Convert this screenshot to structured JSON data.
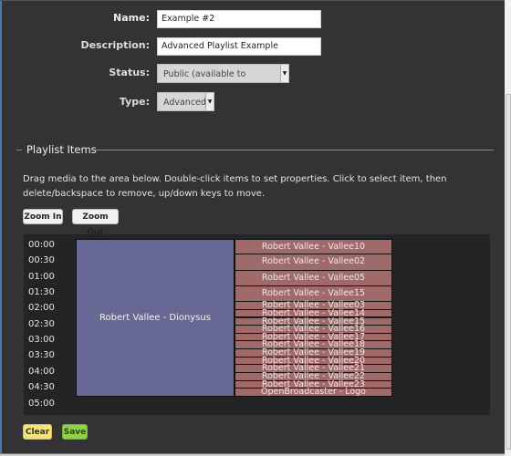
{
  "form": {
    "name_label": "Name:",
    "name_value": "Example #2",
    "description_label": "Description:",
    "description_value": "Advanced Playlist Example",
    "status_label": "Status:",
    "status_value": "Public (available to everyone)",
    "type_label": "Type:",
    "type_value": "Advanced"
  },
  "playlist": {
    "legend": "Playlist Items",
    "help_text": "Drag media to the area below. Double-click items to set properties. Click to select item, then delete/backspace to remove, up/down keys to move.",
    "zoom_in_label": "Zoom In",
    "zoom_out_label": "Zoom Out",
    "time_ticks": [
      "00:00",
      "00:30",
      "01:00",
      "01:30",
      "02:00",
      "02:30",
      "03:00",
      "03:30",
      "04:00",
      "04:30",
      "05:00"
    ],
    "timeline_total_minutes": 300,
    "main_track": {
      "label": "Robert Vallee - Dionysus",
      "start_min": 0,
      "duration_min": 300,
      "color": "#686894"
    },
    "overlay_items": [
      {
        "label": "Robert Vallee - Vallee10",
        "duration_min": 30
      },
      {
        "label": "Robert Vallee - Vallee02",
        "duration_min": 30
      },
      {
        "label": "Robert Vallee - Vallee05",
        "duration_min": 30
      },
      {
        "label": "Robert Vallee - Vallee15",
        "duration_min": 30
      },
      {
        "label": "Robert Vallee - Vallee03",
        "duration_min": 15
      },
      {
        "label": "Robert Vallee - Vallee14",
        "duration_min": 15
      },
      {
        "label": "Robert Vallee - Vallee15",
        "duration_min": 15
      },
      {
        "label": "Robert Vallee - Vallee16",
        "duration_min": 15
      },
      {
        "label": "Robert Vallee - Vallee17",
        "duration_min": 15
      },
      {
        "label": "Robert Vallee - Vallee18",
        "duration_min": 15
      },
      {
        "label": "Robert Vallee - Vallee19",
        "duration_min": 15
      },
      {
        "label": "Robert Vallee - Vallee20",
        "duration_min": 15
      },
      {
        "label": "Robert Vallee - Vallee21",
        "duration_min": 15
      },
      {
        "label": "Robert Vallee - Vallee22",
        "duration_min": 15
      },
      {
        "label": "Robert Vallee - Vallee23",
        "duration_min": 15
      },
      {
        "label": "OpenBroadcaster - Logo",
        "duration_min": 15
      }
    ],
    "overlay_color": "#a06a6a"
  },
  "actions": {
    "clear_label": "Clear",
    "save_label": "Save"
  }
}
